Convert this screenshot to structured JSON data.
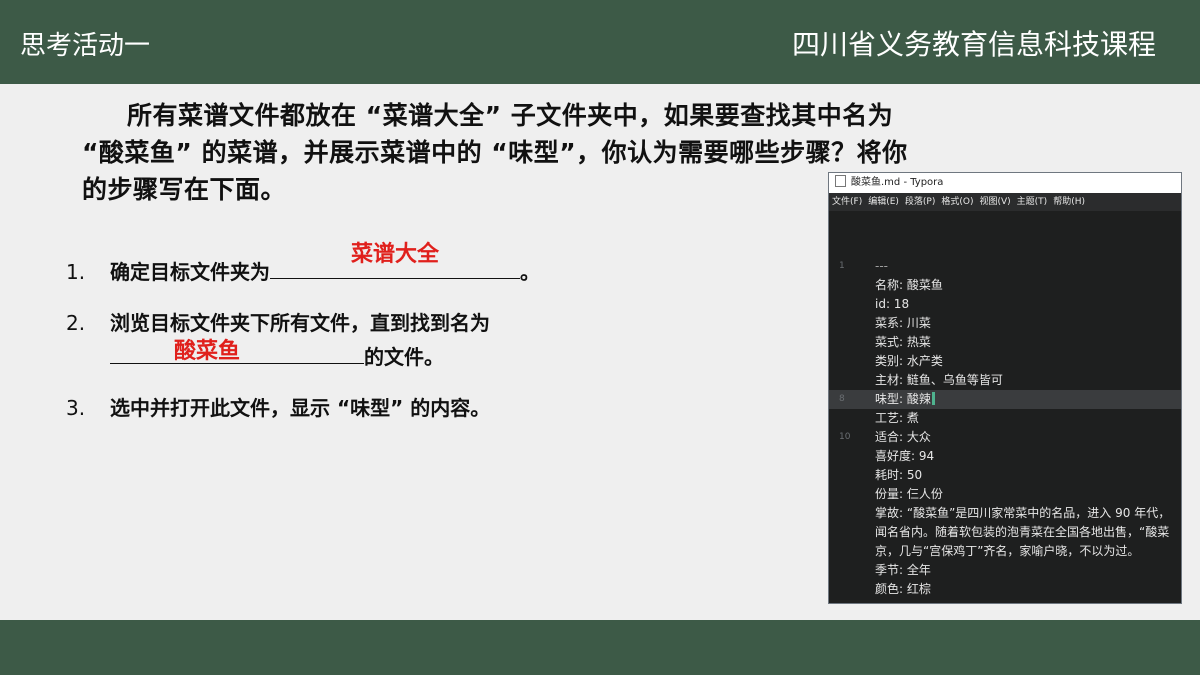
{
  "header": {
    "left_title": "思考活动一",
    "right_title": "四川省义务教育信息科技课程"
  },
  "question": {
    "line1": "所有菜谱文件都放在 “菜谱大全” 子文件夹中，如果要查找其中名为",
    "line2": "“酸菜鱼” 的菜谱，并展示菜谱中的 “味型”，你认为需要哪些步骤？将你",
    "line3": "的步骤写在下面。"
  },
  "steps": [
    {
      "num": "1.",
      "text_before": "确定目标文件夹为",
      "answer": "菜谱大全",
      "text_after": "。"
    },
    {
      "num": "2.",
      "text_before": "浏览目标文件夹下所有文件，直到找到名为",
      "answer": "酸菜鱼",
      "text_after": "的文件。"
    },
    {
      "num": "3.",
      "text": "选中并打开此文件，显示 “味型” 的内容。"
    }
  ],
  "typora": {
    "title": "酸菜鱼.md - Typora",
    "menu": [
      "文件(F)",
      "编辑(E)",
      "段落(P)",
      "格式(O)",
      "视图(V)",
      "主题(T)",
      "帮助(H)"
    ],
    "lines": [
      {
        "no": "1",
        "text": "---"
      },
      {
        "no": "",
        "text": "名称: 酸菜鱼"
      },
      {
        "no": "",
        "text": "id: 18"
      },
      {
        "no": "",
        "text": "菜系: 川菜"
      },
      {
        "no": "",
        "text": "菜式: 热菜"
      },
      {
        "no": "",
        "text": "类别: 水产类"
      },
      {
        "no": "",
        "text": "主材: 鲢鱼、乌鱼等皆可"
      },
      {
        "no": "8",
        "text": "味型: 酸辣"
      },
      {
        "no": "",
        "text": "工艺: 煮"
      },
      {
        "no": "10",
        "text": "适合: 大众"
      },
      {
        "no": "",
        "text": "喜好度: 94"
      },
      {
        "no": "",
        "text": "耗时: 50"
      },
      {
        "no": "",
        "text": "份量: 仨人份"
      },
      {
        "no": "",
        "text": "掌故: “酸菜鱼”是四川家常菜中的名品，进入 90 年代，"
      },
      {
        "no": "",
        "text": "闻名省内。随着软包装的泡青菜在全国各地出售，“酸菜"
      },
      {
        "no": "",
        "text": "京，几与“宫保鸡丁”齐名，家喻户晓，不以为过。"
      },
      {
        "no": "",
        "text": "季节: 全年"
      },
      {
        "no": "",
        "text": "颜色: 红棕"
      }
    ],
    "current_line": "8"
  }
}
